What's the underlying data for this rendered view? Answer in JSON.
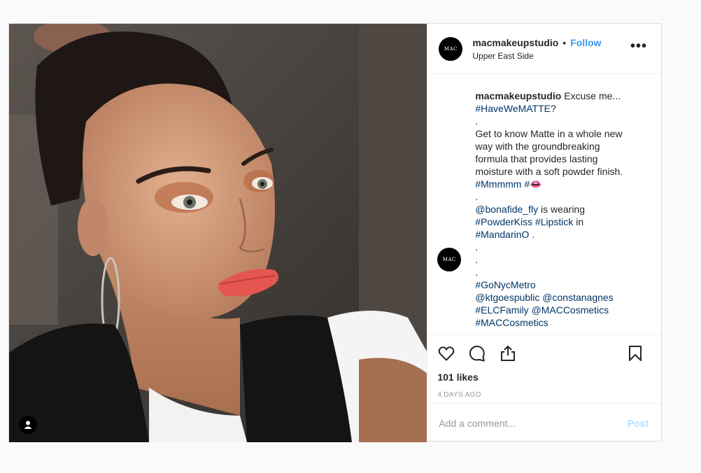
{
  "header": {
    "username": "macmakeupstudio",
    "separator": "•",
    "follow_label": "Follow",
    "location": "Upper East Side",
    "more_label": "•••",
    "avatar_text": "MAC"
  },
  "caption": {
    "username": "macmakeupstudio",
    "lines": [
      [
        {
          "t": "Excuse me..."
        }
      ],
      [
        {
          "t": "#HaveWeMATTE",
          "tag": true
        },
        {
          "t": "?"
        }
      ],
      [
        {
          "t": "."
        }
      ],
      [
        {
          "t": "Get to know Matte in a whole new"
        }
      ],
      [
        {
          "t": "way with the groundbreaking"
        }
      ],
      [
        {
          "t": "formula that provides lasting"
        }
      ],
      [
        {
          "t": "moisture with a soft powder finish."
        }
      ],
      [
        {
          "t": "#Mmmmm",
          "tag": true
        },
        {
          "t": " "
        },
        {
          "t": "#👄",
          "tag": true
        }
      ],
      [
        {
          "t": "."
        }
      ],
      [
        {
          "t": "@bonafide_fly",
          "tag": true
        },
        {
          "t": " is wearing"
        }
      ],
      [
        {
          "t": "#PowderKiss",
          "tag": true
        },
        {
          "t": " "
        },
        {
          "t": "#Lipstick",
          "tag": true
        },
        {
          "t": " in"
        }
      ],
      [
        {
          "t": "#MandarinO",
          "tag": true
        },
        {
          "t": " ."
        }
      ],
      [
        {
          "t": "."
        }
      ],
      [
        {
          "t": "."
        }
      ],
      [
        {
          "t": "."
        }
      ],
      [
        {
          "t": "#GoNycMetro",
          "tag": true
        }
      ],
      [
        {
          "t": "@ktgoespublic",
          "tag": true
        },
        {
          "t": " "
        },
        {
          "t": "@constanagnes",
          "tag": true
        }
      ],
      [
        {
          "t": "#ELCFamily",
          "tag": true
        },
        {
          "t": " "
        },
        {
          "t": "@MACCosmetics",
          "tag": true
        }
      ],
      [
        {
          "t": "#MACCosmetics",
          "tag": true
        }
      ]
    ]
  },
  "actions": {
    "like_icon": "heart-icon",
    "comment_icon": "comment-icon",
    "share_icon": "share-icon",
    "save_icon": "bookmark-icon",
    "likes": "101 likes",
    "time": "4 DAYS AGO"
  },
  "comment_box": {
    "placeholder": "Add a comment...",
    "post_label": "Post"
  },
  "colors": {
    "follow": "#3897f0",
    "hashtag": "#003569",
    "post_disabled": "#b2dffc",
    "border": "#dbdbdb"
  }
}
